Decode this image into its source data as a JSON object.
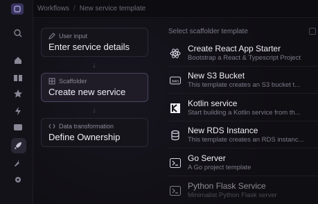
{
  "breadcrumb": {
    "root": "Workflows",
    "separator": "/",
    "current": "New service template"
  },
  "sidebar": {
    "icons": [
      "search-icon",
      "home-icon",
      "book-icon",
      "star-icon",
      "bolt-icon",
      "chat-icon",
      "rocket-icon",
      "wrench-icon",
      "settings-icon"
    ]
  },
  "steps": [
    {
      "sub": "User input",
      "title": "Enter service details",
      "icon": "pencil-icon"
    },
    {
      "sub": "Scaffolder",
      "title": "Create new service",
      "icon": "grid-icon"
    },
    {
      "sub": "Data transformation",
      "title": "Define Ownership",
      "icon": "code-icon"
    }
  ],
  "templates": {
    "header": "Select scaffolder template",
    "items": [
      {
        "title": "Create React App Starter",
        "desc": "Bootstrap a React & Typescript Project",
        "icon": "react-icon"
      },
      {
        "title": "New S3 Bucket",
        "desc": "This template creates an S3 bucket t...",
        "icon": "aws-icon"
      },
      {
        "title": "Kotlin service",
        "desc": "Start building a Kotlin service from th...",
        "icon": "kotlin-icon"
      },
      {
        "title": "New RDS Instance",
        "desc": "This template creates an RDS instanc...",
        "icon": "database-icon"
      },
      {
        "title": "Go Server",
        "desc": "A Go project template",
        "icon": "terminal-icon"
      },
      {
        "title": "Python Flask Service",
        "desc": "Minimalist Python Flask server",
        "icon": "terminal-icon"
      }
    ]
  },
  "colors": {
    "background": "#0d0c10",
    "card": "#16141b",
    "active_card": "#1f1c28",
    "text": "#f1eff6",
    "muted": "#7d7a88"
  }
}
